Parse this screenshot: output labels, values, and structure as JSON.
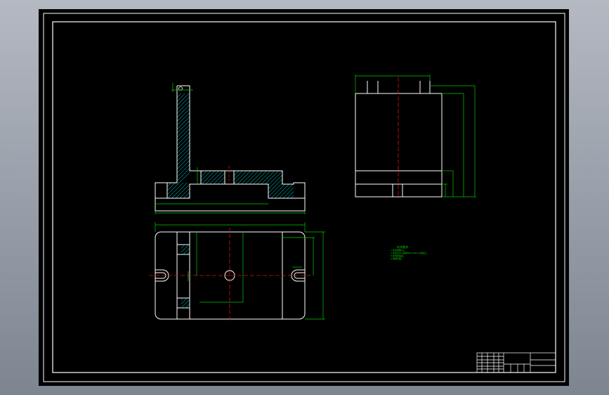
{
  "viewport": {
    "background_gradient": [
      "#b4b9c2",
      "#7d8591"
    ],
    "sheet_color": "#000000",
    "frame_color": "#ffffff",
    "outline_color": "#ffffff",
    "dimension_color": "#00cc00",
    "hatch_color": "#00bcbc",
    "centerline_color": "#e01010",
    "note_color": "#00dd00"
  },
  "notes": {
    "heading": "技术要求",
    "lines": [
      "1.未注倒角C1。",
      "2.未注尺寸公差按GB/T1804-m级加工。",
      "3.去毛刺锐边。",
      "4.调质处理。"
    ]
  },
  "title_block": {
    "rows": 6
  }
}
